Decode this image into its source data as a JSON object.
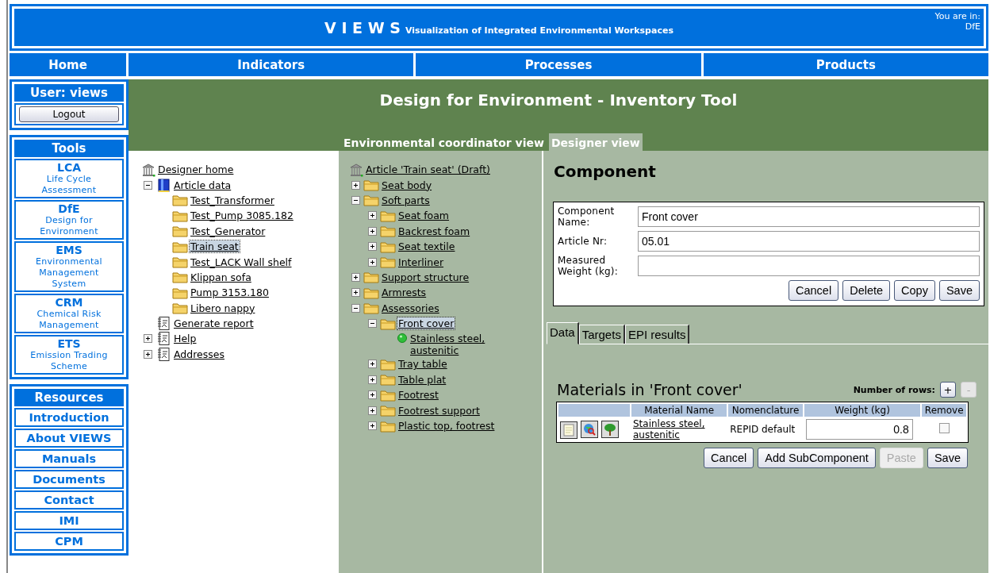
{
  "header": {
    "logo": "V I E W S",
    "subtitle": "Visualization of Integrated Environmental Workspaces",
    "location_label": "You are in:",
    "location": "DfE"
  },
  "nav": [
    "Home",
    "Indicators",
    "Processes",
    "Products"
  ],
  "sidebar": {
    "user": {
      "title": "User: views",
      "logout": "Logout"
    },
    "tools": {
      "title": "Tools",
      "items": [
        {
          "abbr": "LCA",
          "name": "Life Cycle Assessment"
        },
        {
          "abbr": "DfE",
          "name": "Design for Environment"
        },
        {
          "abbr": "EMS",
          "name": "Environmental Management System"
        },
        {
          "abbr": "CRM",
          "name": "Chemical Risk Management"
        },
        {
          "abbr": "ETS",
          "name": "Emission Trading Scheme"
        }
      ]
    },
    "resources": {
      "title": "Resources",
      "items": [
        "Introduction",
        "About VIEWS",
        "Manuals",
        "Documents",
        "Contact",
        "IMI",
        "CPM"
      ]
    }
  },
  "main": {
    "title": "Design for Environment - Inventory Tool",
    "view_tabs": [
      {
        "label": "Environmental coordinator view",
        "selected": false
      },
      {
        "label": "Designer view",
        "selected": true
      }
    ]
  },
  "designer_tree": {
    "root": {
      "label": "Designer home",
      "kind": "home"
    },
    "items": [
      {
        "label": "Article data",
        "kind": "article",
        "expanded": true,
        "selected": false,
        "children": [
          {
            "label": "Test_Transformer",
            "kind": "folder",
            "selected": false
          },
          {
            "label": "Test_Pump 3085.182",
            "kind": "folder",
            "selected": false
          },
          {
            "label": "Test_Generator",
            "kind": "folder",
            "selected": false
          },
          {
            "label": "Train seat",
            "kind": "folder",
            "selected": true
          },
          {
            "label": "Test_LACK Wall shelf",
            "kind": "folder",
            "selected": false
          },
          {
            "label": "Klippan sofa",
            "kind": "folder",
            "selected": false
          },
          {
            "label": "Pump 3153.180",
            "kind": "folder",
            "selected": false
          },
          {
            "label": "Libero nappy",
            "kind": "folder",
            "selected": false
          }
        ]
      },
      {
        "label": "Generate report",
        "kind": "report",
        "selected": false
      },
      {
        "label": "Help",
        "kind": "report",
        "expanded": false,
        "selected": false
      },
      {
        "label": "Addresses",
        "kind": "report",
        "expanded": false,
        "selected": false
      }
    ]
  },
  "article_tree": {
    "root": {
      "label": "Article 'Train seat' (Draft)",
      "kind": "home"
    },
    "items": [
      {
        "label": "Seat body",
        "kind": "folder",
        "expanded": false,
        "selected": false
      },
      {
        "label": "Soft parts",
        "kind": "folder",
        "expanded": true,
        "selected": false,
        "children": [
          {
            "label": "Seat foam",
            "kind": "folder",
            "expanded": false,
            "selected": false
          },
          {
            "label": "Backrest foam",
            "kind": "folder",
            "expanded": false,
            "selected": false
          },
          {
            "label": "Seat textile",
            "kind": "folder",
            "expanded": false,
            "selected": false
          },
          {
            "label": "Interliner",
            "kind": "folder",
            "expanded": false,
            "selected": false
          }
        ]
      },
      {
        "label": "Support structure",
        "kind": "folder",
        "expanded": false,
        "selected": false
      },
      {
        "label": "Armrests",
        "kind": "folder",
        "expanded": false,
        "selected": false
      },
      {
        "label": "Assessories",
        "kind": "folder",
        "expanded": true,
        "selected": false,
        "children": [
          {
            "label": "Front cover",
            "kind": "folder",
            "expanded": true,
            "selected": true,
            "children": [
              {
                "label": "Stainless steel, austenitic",
                "kind": "material",
                "selected": false
              }
            ]
          },
          {
            "label": "Tray table",
            "kind": "folder",
            "expanded": false,
            "selected": false
          },
          {
            "label": "Table plat",
            "kind": "folder",
            "expanded": false,
            "selected": false
          },
          {
            "label": "Footrest",
            "kind": "folder",
            "expanded": false,
            "selected": false
          },
          {
            "label": "Footrest support",
            "kind": "folder",
            "expanded": false,
            "selected": false
          },
          {
            "label": "Plastic top, footrest",
            "kind": "folder",
            "expanded": false,
            "selected": false
          }
        ]
      }
    ]
  },
  "component": {
    "heading": "Component",
    "fields": [
      {
        "label": "Component Name:",
        "value": "Front cover"
      },
      {
        "label": "Article Nr:",
        "value": "05.01"
      },
      {
        "label": "Measured Weight (kg):"
      }
    ],
    "buttons": [
      "Cancel",
      "Delete",
      "Copy",
      "Save"
    ]
  },
  "detail_tabs": [
    {
      "label": "Data",
      "selected": true
    },
    {
      "label": "Targets",
      "selected": false
    },
    {
      "label": "EPI results",
      "selected": false
    }
  ],
  "materials": {
    "title": "Materials in 'Front cover'",
    "rows_label": "Number of rows:",
    "row_buttons": [
      {
        "label": "+",
        "disabled": false
      },
      {
        "label": "-",
        "disabled": true
      }
    ],
    "columns": [
      "Material Name",
      "Nomenclature",
      "Weight (kg)",
      "Remove"
    ],
    "rows": [
      {
        "name": "Stainless steel, austenitic",
        "nomenclature": "REPID default",
        "weight": "0.8",
        "remove": false
      }
    ],
    "buttons": [
      {
        "label": "Cancel",
        "disabled": false
      },
      {
        "label": "Add SubComponent",
        "disabled": false
      },
      {
        "label": "Paste",
        "disabled": true
      },
      {
        "label": "Save",
        "disabled": false
      }
    ]
  }
}
